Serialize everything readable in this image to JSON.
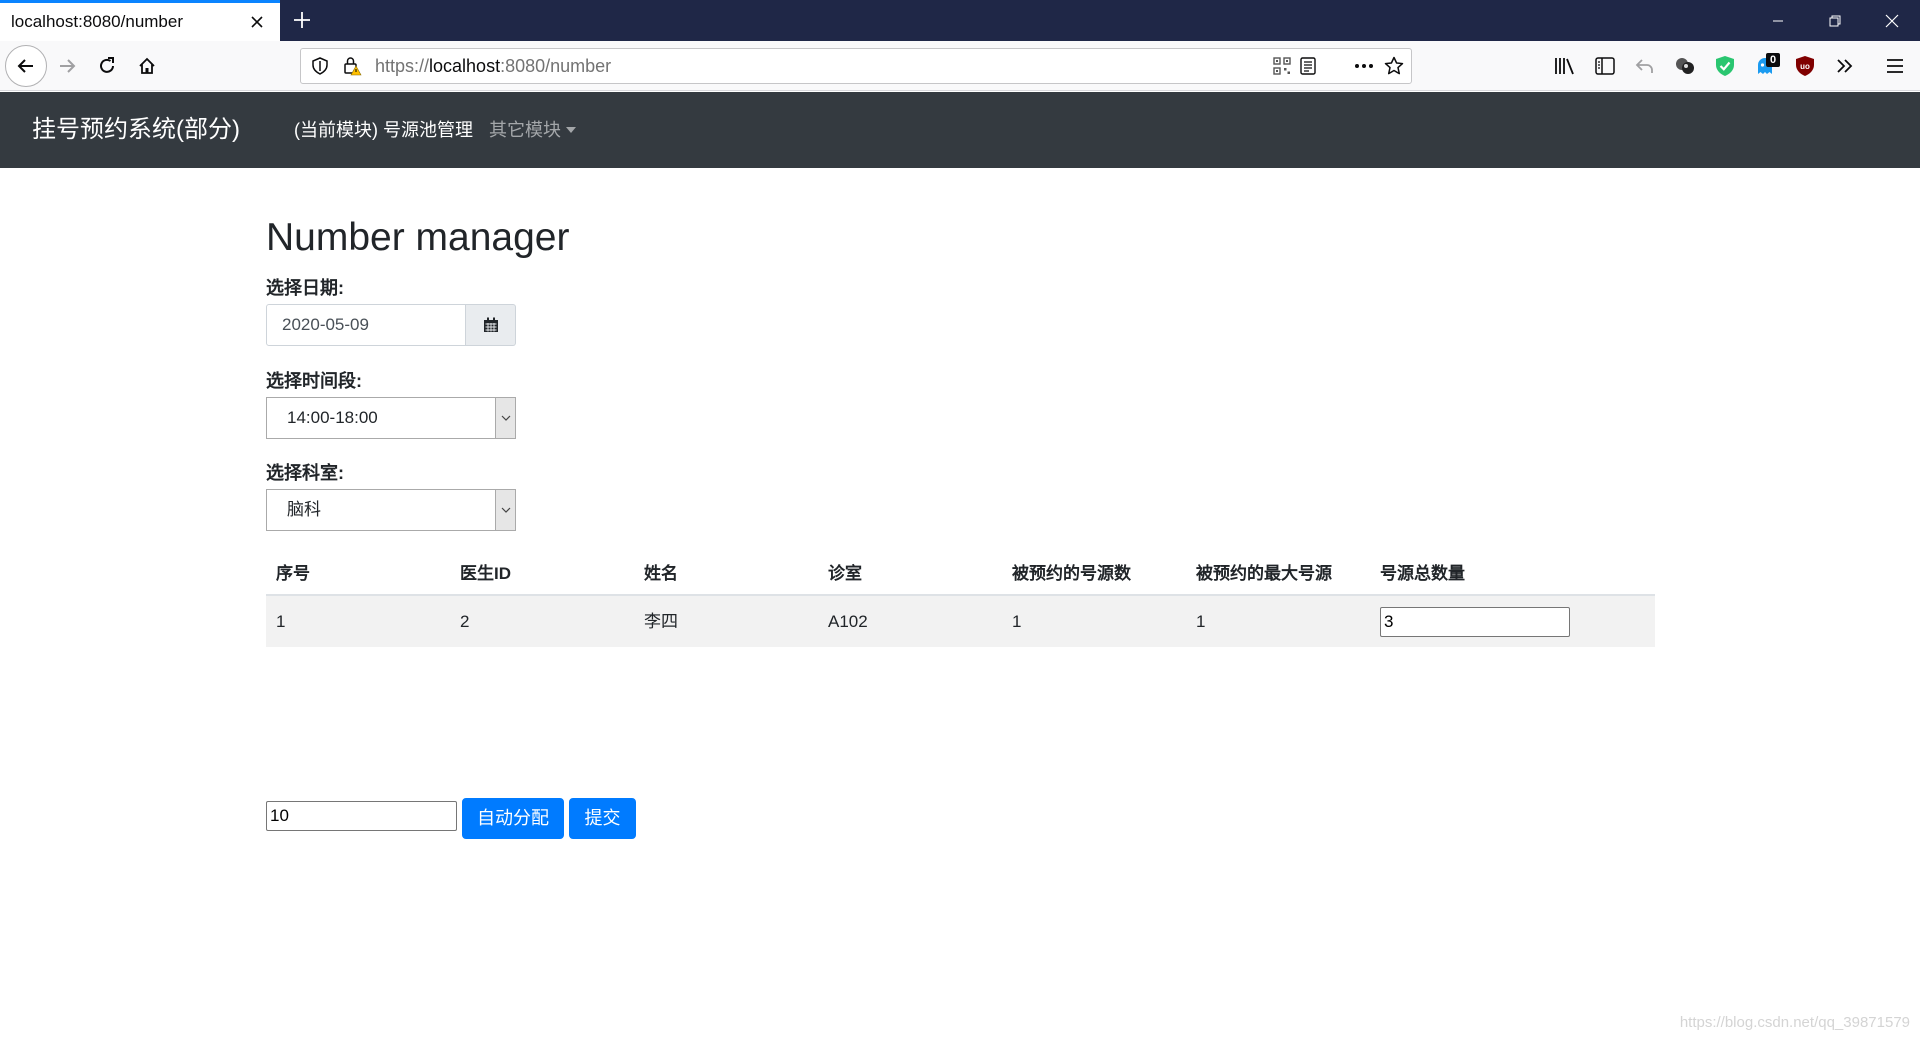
{
  "browser": {
    "tab_title": "localhost:8080/number",
    "url_host": "localhost",
    "url_prefix": "https://",
    "url_rest": ":8080/number",
    "extension_badge": "0"
  },
  "app": {
    "brand": "挂号预约系统(部分)",
    "nav": {
      "current_module": "(当前模块) 号源池管理",
      "other_modules": "其它模块"
    }
  },
  "page": {
    "title": "Number manager",
    "date_label": "选择日期:",
    "date_value": "2020-05-09",
    "time_label": "选择时间段:",
    "time_value": "14:00-18:00",
    "dept_label": "选择科室:",
    "dept_value": "脑科"
  },
  "table": {
    "headers": [
      "序号",
      "医生ID",
      "姓名",
      "诊室",
      "被预约的号源数",
      "被预约的最大号源",
      "号源总数量"
    ],
    "rows": [
      {
        "index": "1",
        "doctor_id": "2",
        "name": "李四",
        "room": "A102",
        "booked": "1",
        "max_booked": "1",
        "total": "3"
      }
    ]
  },
  "actions": {
    "auto_value": "10",
    "auto_button": "自动分配",
    "submit_button": "提交"
  },
  "watermark": "https://blog.csdn.net/qq_39871579"
}
